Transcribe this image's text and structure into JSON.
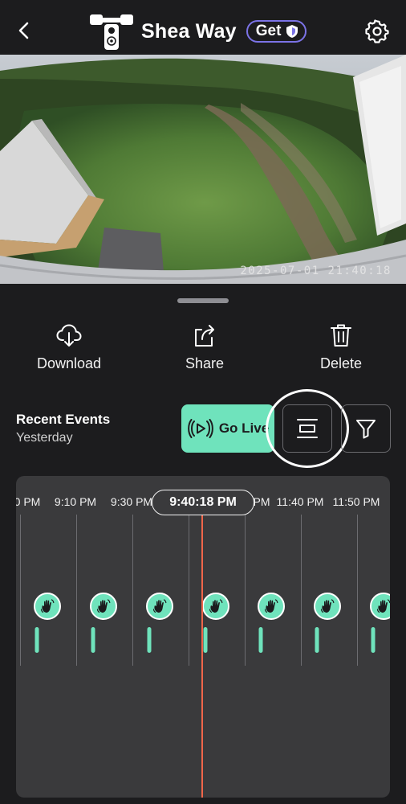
{
  "header": {
    "title": "Shea Way",
    "get_label": "Get"
  },
  "camera": {
    "timestamp": "2025-07-01 21:40:18"
  },
  "actions": [
    {
      "label": "Download",
      "icon": "cloud-download-icon"
    },
    {
      "label": "Share",
      "icon": "share-icon"
    },
    {
      "label": "Delete",
      "icon": "trash-icon"
    }
  ],
  "recent": {
    "title": "Recent Events",
    "subtitle": "Yesterday"
  },
  "go_live": {
    "label": "Go Live"
  },
  "timeline": {
    "current_time": "9:40:18 PM",
    "tick_labels": [
      "0 PM",
      "9:10 PM",
      "9:30 PM",
      "PM",
      "11:40 PM",
      "11:50 PM"
    ],
    "event_icon": "motion-hand-icon"
  },
  "colors": {
    "accent": "#6fe3bc",
    "playhead": "#f0664a",
    "pill_border": "#7b73e6",
    "background": "#1c1c1e"
  }
}
